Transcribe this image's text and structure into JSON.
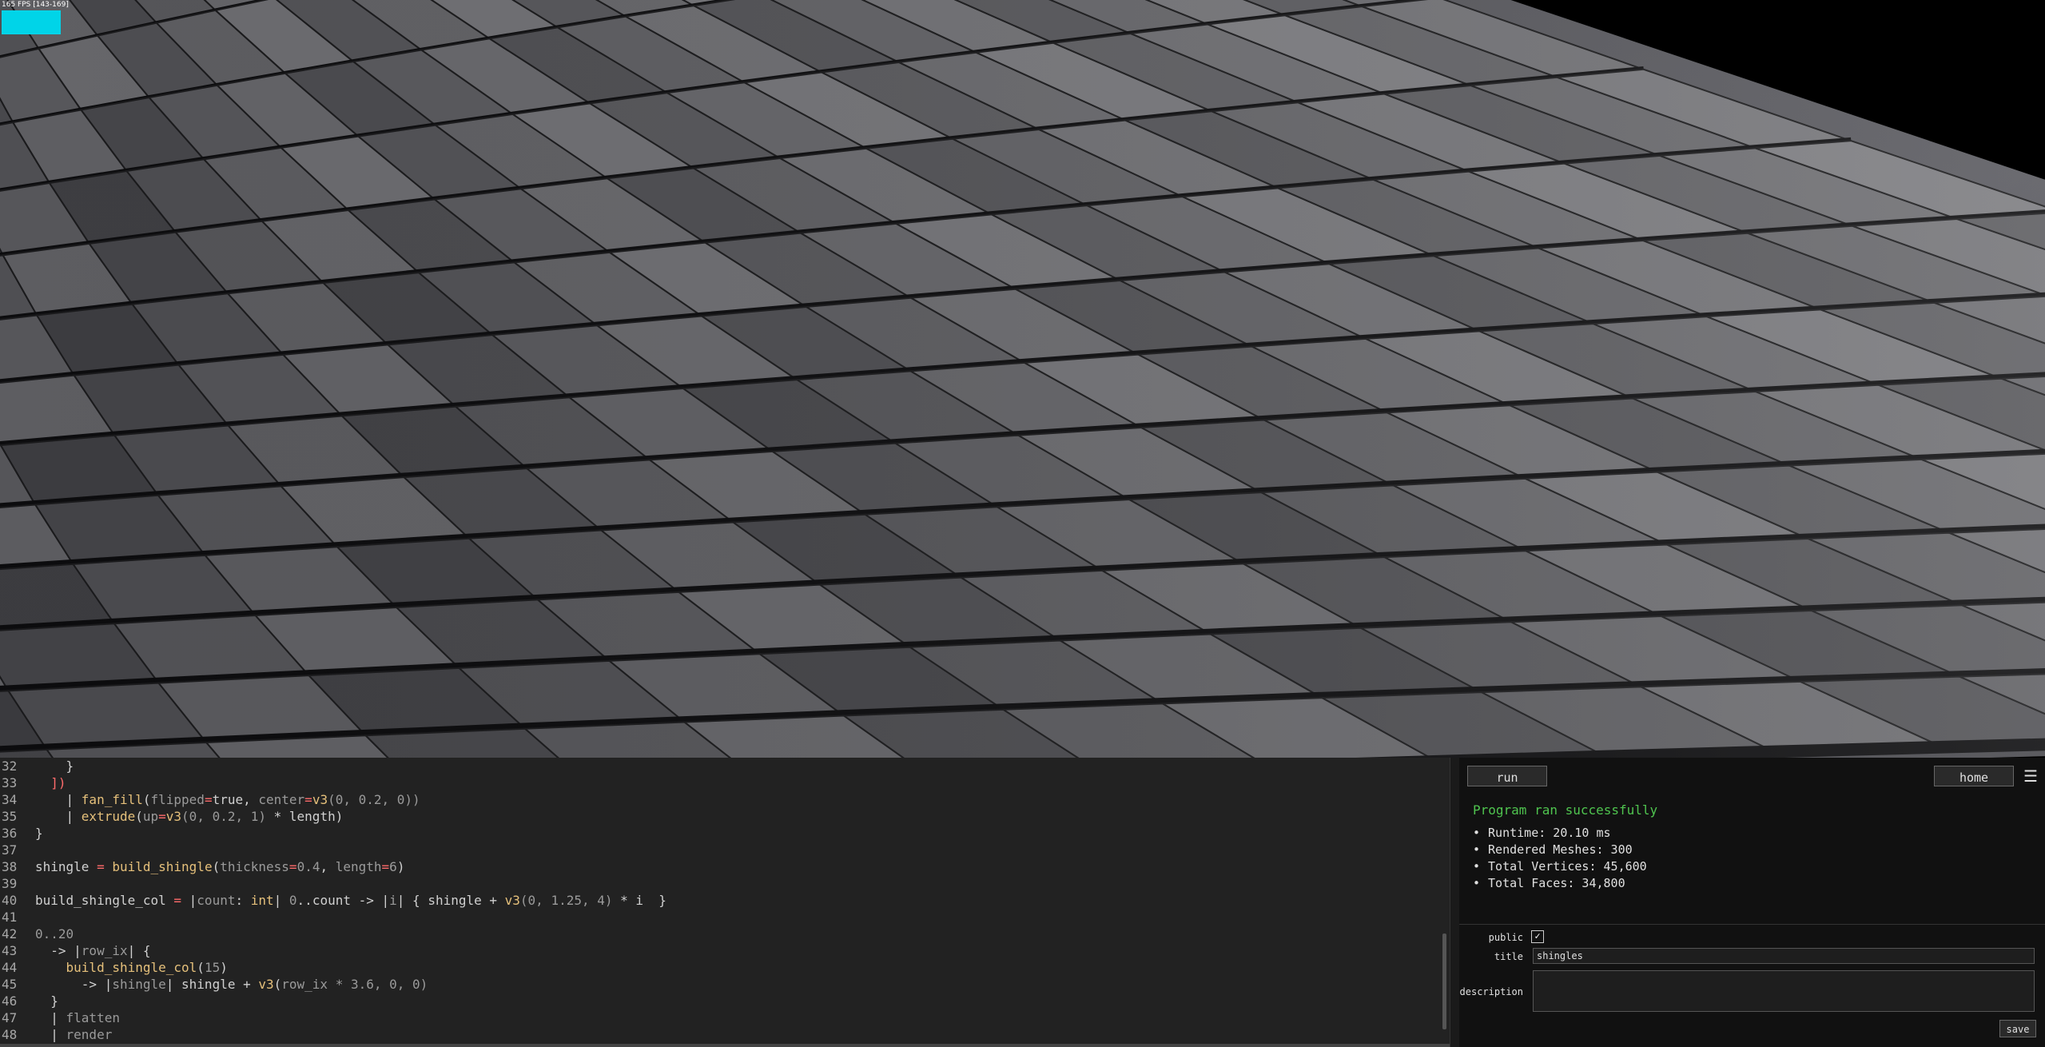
{
  "viewport": {
    "fps_text": "165 FPS [143-169]"
  },
  "editor": {
    "lines": [
      {
        "n": "32",
        "tokens": [
          {
            "t": "    }",
            "c": "src"
          }
        ]
      },
      {
        "n": "33",
        "tokens": [
          {
            "t": "  ])",
            "c": "op"
          }
        ]
      },
      {
        "n": "34",
        "tokens": [
          {
            "t": "    | ",
            "c": "src"
          },
          {
            "t": "fan_fill",
            "c": "kw"
          },
          {
            "t": "(",
            "c": "src"
          },
          {
            "t": "flipped",
            "c": "va"
          },
          {
            "t": "=",
            "c": "op"
          },
          {
            "t": "true, ",
            "c": "src"
          },
          {
            "t": "center",
            "c": "va"
          },
          {
            "t": "=",
            "c": "op"
          },
          {
            "t": "v3",
            "c": "kw"
          },
          {
            "t": "(0, 0.2, 0))",
            "c": "nm"
          }
        ]
      },
      {
        "n": "35",
        "tokens": [
          {
            "t": "    | ",
            "c": "src"
          },
          {
            "t": "extrude",
            "c": "kw"
          },
          {
            "t": "(",
            "c": "src"
          },
          {
            "t": "up",
            "c": "va"
          },
          {
            "t": "=",
            "c": "op"
          },
          {
            "t": "v3",
            "c": "kw"
          },
          {
            "t": "(0, 0.2, 1) ",
            "c": "nm"
          },
          {
            "t": "* length)",
            "c": "src"
          }
        ]
      },
      {
        "n": "36",
        "tokens": [
          {
            "t": "}",
            "c": "src"
          }
        ]
      },
      {
        "n": "37",
        "tokens": [
          {
            "t": "",
            "c": "src"
          }
        ]
      },
      {
        "n": "38",
        "tokens": [
          {
            "t": "shingle ",
            "c": "src"
          },
          {
            "t": "=",
            "c": "op"
          },
          {
            "t": " ",
            "c": "src"
          },
          {
            "t": "build_shingle",
            "c": "kw"
          },
          {
            "t": "(",
            "c": "src"
          },
          {
            "t": "thickness",
            "c": "va"
          },
          {
            "t": "=",
            "c": "op"
          },
          {
            "t": "0.4",
            "c": "nm"
          },
          {
            "t": ", ",
            "c": "src"
          },
          {
            "t": "length",
            "c": "va"
          },
          {
            "t": "=",
            "c": "op"
          },
          {
            "t": "6",
            "c": "nm"
          },
          {
            "t": ")",
            "c": "src"
          }
        ]
      },
      {
        "n": "39",
        "tokens": [
          {
            "t": "",
            "c": "src"
          }
        ]
      },
      {
        "n": "40",
        "tokens": [
          {
            "t": "build_shingle_col ",
            "c": "src"
          },
          {
            "t": "=",
            "c": "op"
          },
          {
            "t": " |",
            "c": "src"
          },
          {
            "t": "count",
            "c": "va"
          },
          {
            "t": ": ",
            "c": "src"
          },
          {
            "t": "int",
            "c": "ty"
          },
          {
            "t": "| ",
            "c": "src"
          },
          {
            "t": "0",
            "c": "nm"
          },
          {
            "t": "..count -> |",
            "c": "src"
          },
          {
            "t": "i",
            "c": "va"
          },
          {
            "t": "| { shingle + ",
            "c": "src"
          },
          {
            "t": "v3",
            "c": "kw"
          },
          {
            "t": "(0, 1.25, 4) ",
            "c": "nm"
          },
          {
            "t": "* i  }",
            "c": "src"
          }
        ]
      },
      {
        "n": "41",
        "tokens": [
          {
            "t": "",
            "c": "src"
          }
        ]
      },
      {
        "n": "42",
        "tokens": [
          {
            "t": "0..20",
            "c": "nm"
          }
        ]
      },
      {
        "n": "43",
        "tokens": [
          {
            "t": "  -> |",
            "c": "src"
          },
          {
            "t": "row_ix",
            "c": "va"
          },
          {
            "t": "| {",
            "c": "src"
          }
        ]
      },
      {
        "n": "44",
        "tokens": [
          {
            "t": "    ",
            "c": "src"
          },
          {
            "t": "build_shingle_col",
            "c": "kw"
          },
          {
            "t": "(",
            "c": "src"
          },
          {
            "t": "15",
            "c": "nm"
          },
          {
            "t": ")",
            "c": "src"
          }
        ]
      },
      {
        "n": "45",
        "tokens": [
          {
            "t": "      -> |",
            "c": "src"
          },
          {
            "t": "shingle",
            "c": "va"
          },
          {
            "t": "| shingle + ",
            "c": "src"
          },
          {
            "t": "v3",
            "c": "kw"
          },
          {
            "t": "(",
            "c": "src"
          },
          {
            "t": "row_ix",
            "c": "va"
          },
          {
            "t": " * 3.6, 0, 0)",
            "c": "nm"
          }
        ]
      },
      {
        "n": "46",
        "tokens": [
          {
            "t": "  }",
            "c": "src"
          }
        ]
      },
      {
        "n": "47",
        "tokens": [
          {
            "t": "  | ",
            "c": "src"
          },
          {
            "t": "flatten",
            "c": "va"
          }
        ]
      },
      {
        "n": "48",
        "tokens": [
          {
            "t": "  | ",
            "c": "src"
          },
          {
            "t": "render",
            "c": "va"
          }
        ]
      }
    ]
  },
  "panel": {
    "run_label": "run",
    "home_label": "home",
    "menu_icon": "☰",
    "status": "Program ran successfully",
    "stats": [
      "Runtime: 20.10 ms",
      "Rendered Meshes: 300",
      "Total Vertices: 45,600",
      "Total Faces: 34,800"
    ],
    "public_label": "public",
    "public_checked": "✓",
    "title_label": "title",
    "title_value": "shingles",
    "description_label": "description",
    "description_value": "",
    "save_label": "save"
  },
  "colors": {
    "status_green": "#4fc44f",
    "fps_graph": "#00d4e8",
    "editor_bg": "#222222",
    "panel_bg": "#111111"
  }
}
